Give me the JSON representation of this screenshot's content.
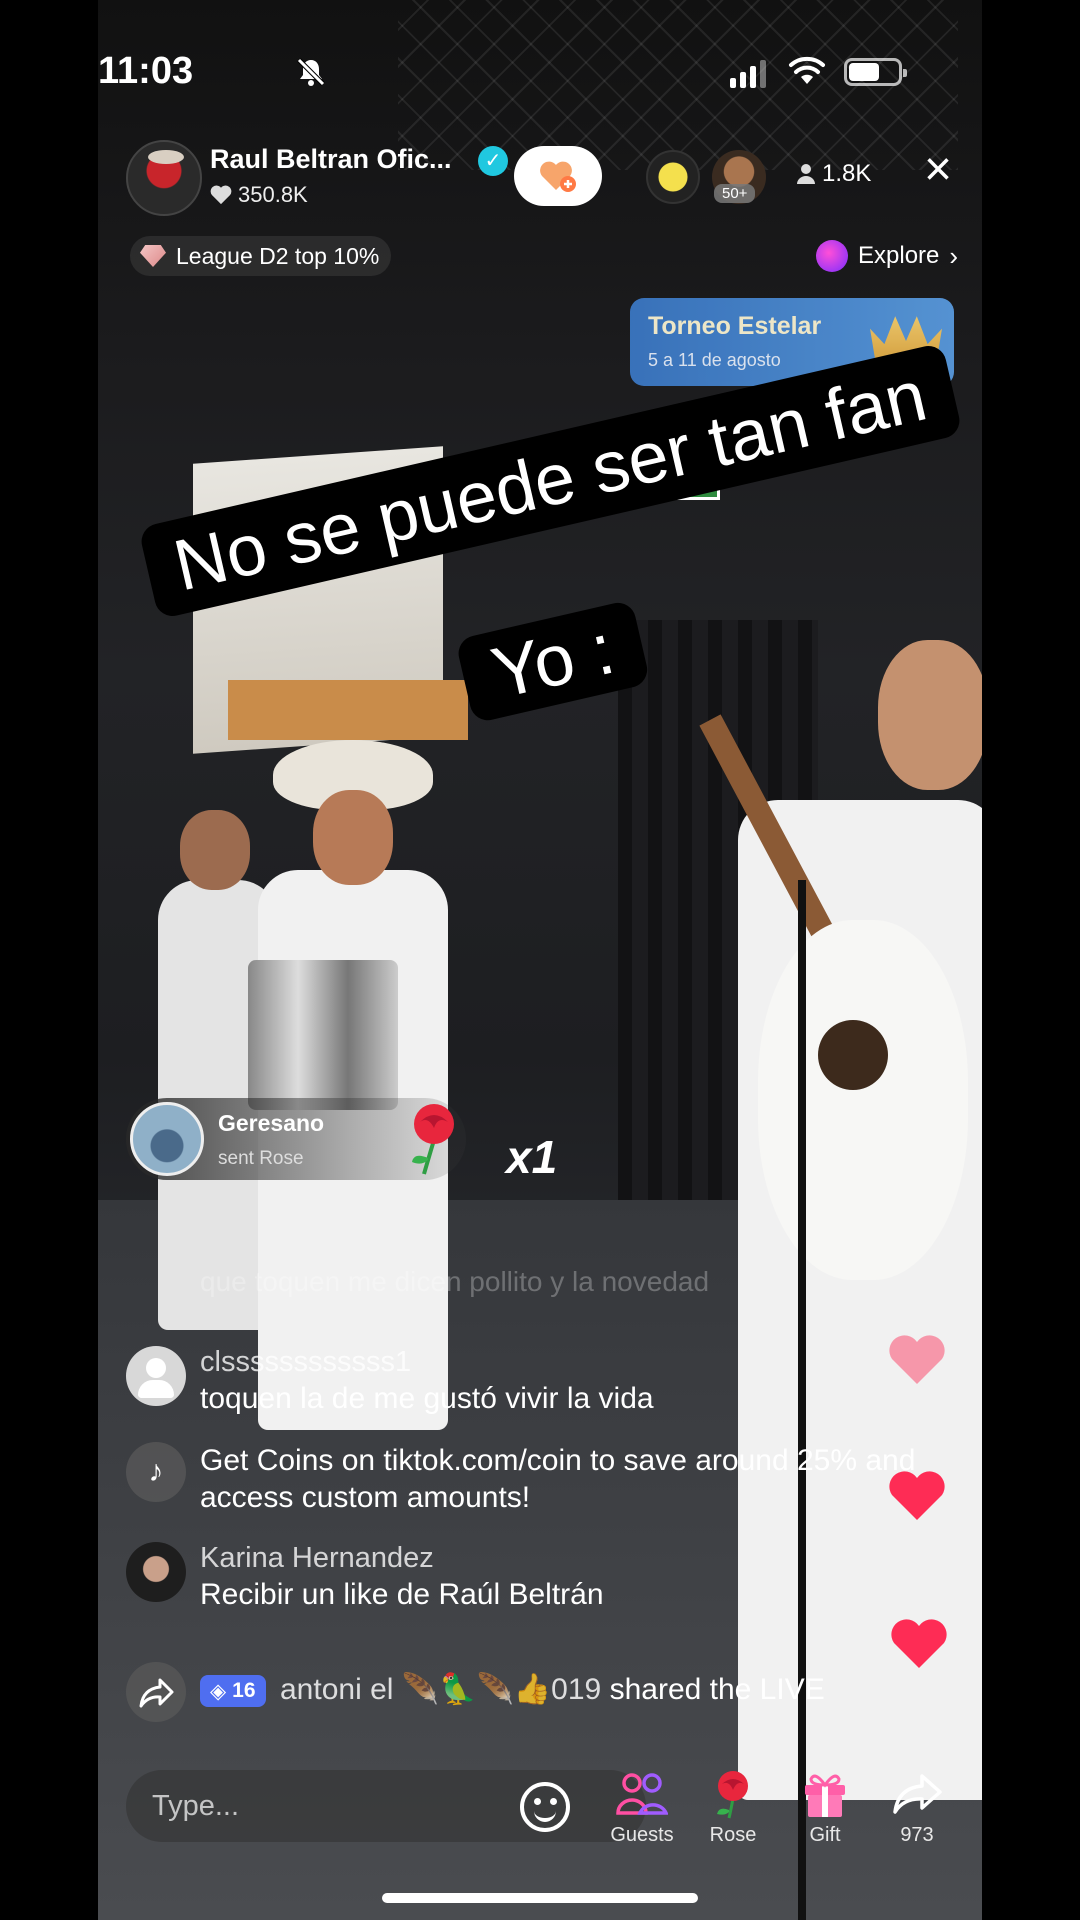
{
  "status_bar": {
    "time": "11:03"
  },
  "host": {
    "name": "Raul Beltran Ofic...",
    "likes": "350.8K"
  },
  "viewers": {
    "badge": "50+",
    "count": "1.8K"
  },
  "league": {
    "label": "League D2 top 10%"
  },
  "explore": {
    "label": "Explore"
  },
  "banner": {
    "title": "Torneo Estelar",
    "subtitle": "5 a 11 de agosto"
  },
  "caption": {
    "line1": "No se puede ser tan fan",
    "line2": "Yo :"
  },
  "gift": {
    "user": "Geresano",
    "action": "sent Rose",
    "count": "x1"
  },
  "chat": {
    "faded": "que toquen me dicen pollito y la novedad",
    "messages": [
      {
        "user": "clssssssssssss1",
        "text": "toquen la de me gustó vivir la vida"
      },
      {
        "user": "",
        "text": "Get Coins on tiktok.com/coin to save around 25% and access custom amounts!"
      },
      {
        "user": "Karina Hernandez",
        "text": "Recibir un like de Raúl Beltrán"
      }
    ],
    "share": {
      "level": "16",
      "user": "antoni el 🪶🦜🪶👍019",
      "action": "shared the LIVE"
    }
  },
  "bottom": {
    "placeholder": "Type...",
    "guests_label": "Guests",
    "rose_label": "Rose",
    "gift_label": "Gift",
    "share_count": "973"
  },
  "colors": {
    "heart": "#fe2c55",
    "verified": "#20c8e0",
    "level_badge": "#4f6ef0"
  }
}
